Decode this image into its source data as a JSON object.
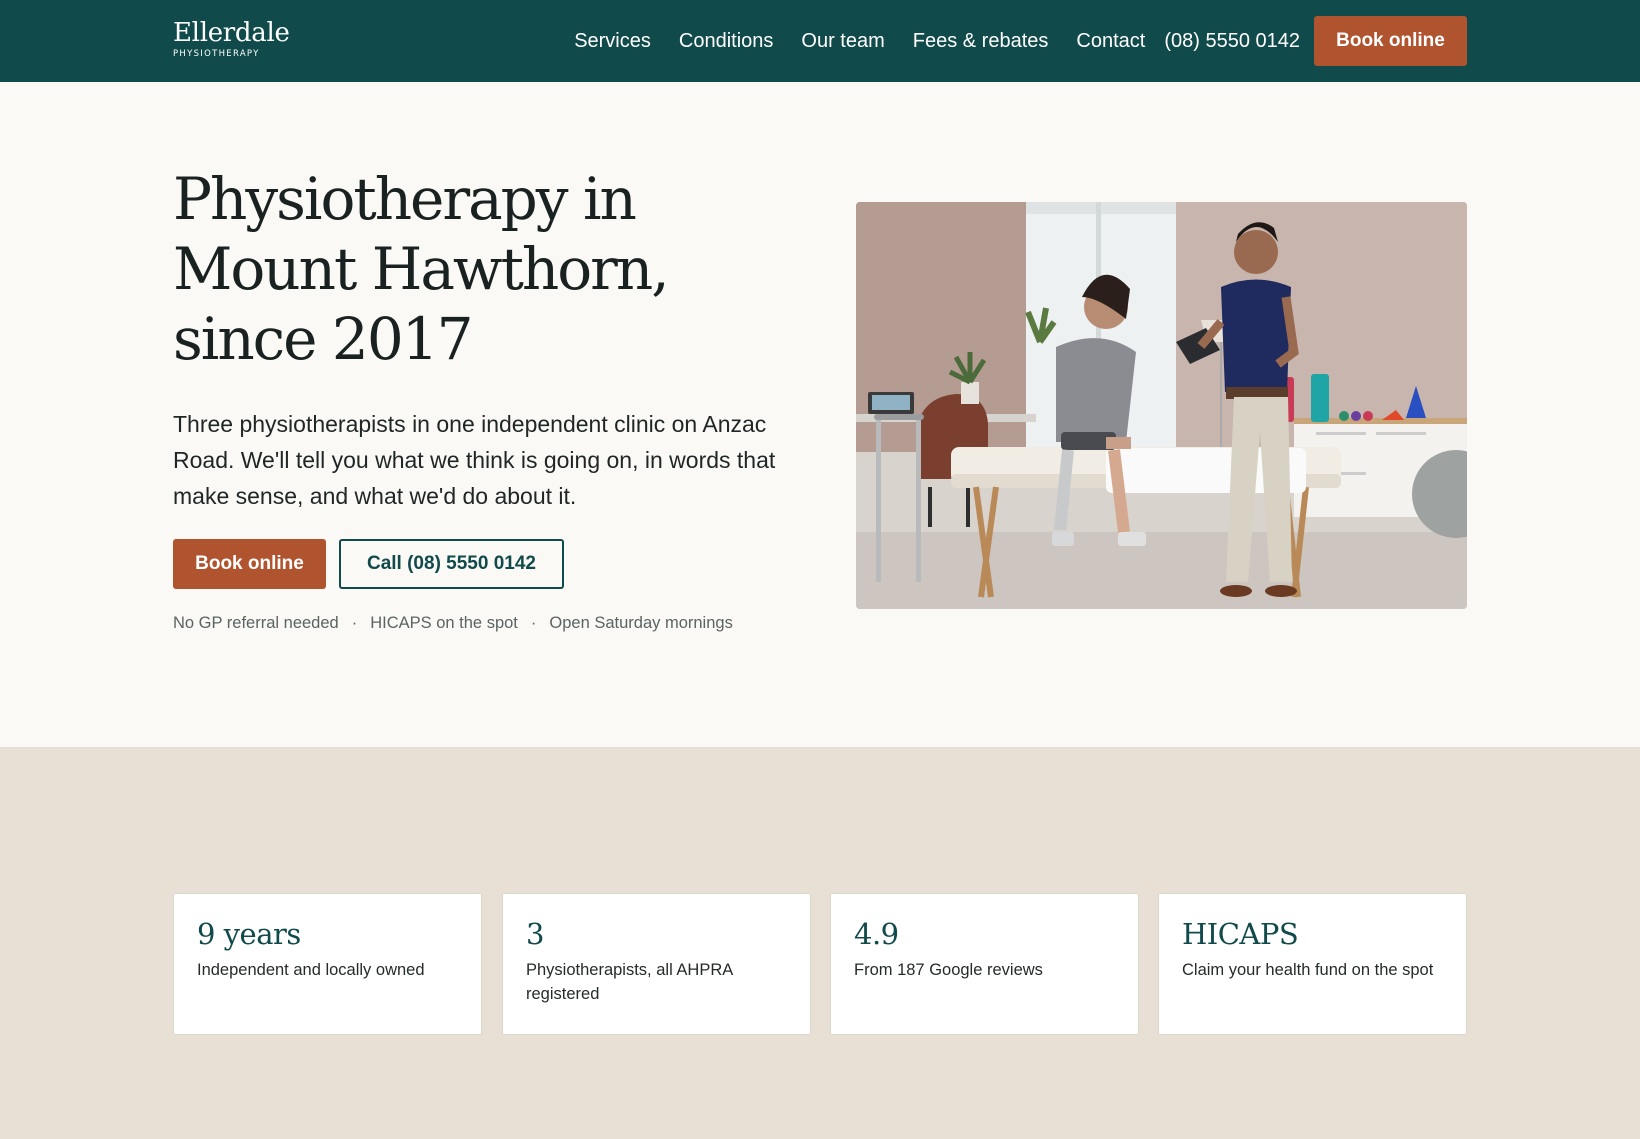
{
  "header": {
    "logo_name": "Ellerdale",
    "logo_sub": "PHYSIOTHERAPY",
    "nav": [
      "Services",
      "Conditions",
      "Our team",
      "Fees & rebates",
      "Contact"
    ],
    "phone": "(08) 5550 0142",
    "book_label": "Book online"
  },
  "hero": {
    "title": "Physiotherapy in Mount Hawthorn, since 2017",
    "text": "Three physiotherapists in one independent clinic on Anzac Road. We'll tell you what we think is going on, in words that make sense, and what we'd do about it.",
    "book_label": "Book online",
    "call_label": "Call (08) 5550 0142",
    "features": [
      "No GP referral needed",
      "HICAPS on the spot",
      "Open Saturday mornings"
    ],
    "separator": "·"
  },
  "stats": [
    {
      "value": "9 years",
      "label": "Independent and locally owned"
    },
    {
      "value": "3",
      "label": "Physiotherapists, all AHPRA registered"
    },
    {
      "value": "4.9",
      "label": "From 187 Google reviews"
    },
    {
      "value": "HICAPS",
      "label": "Claim your health fund on the spot"
    }
  ],
  "colors": {
    "header_bg": "#114a4a",
    "accent": "#b0532f",
    "page_bg": "#faf9f6",
    "band_bg": "#e8e0d5"
  }
}
